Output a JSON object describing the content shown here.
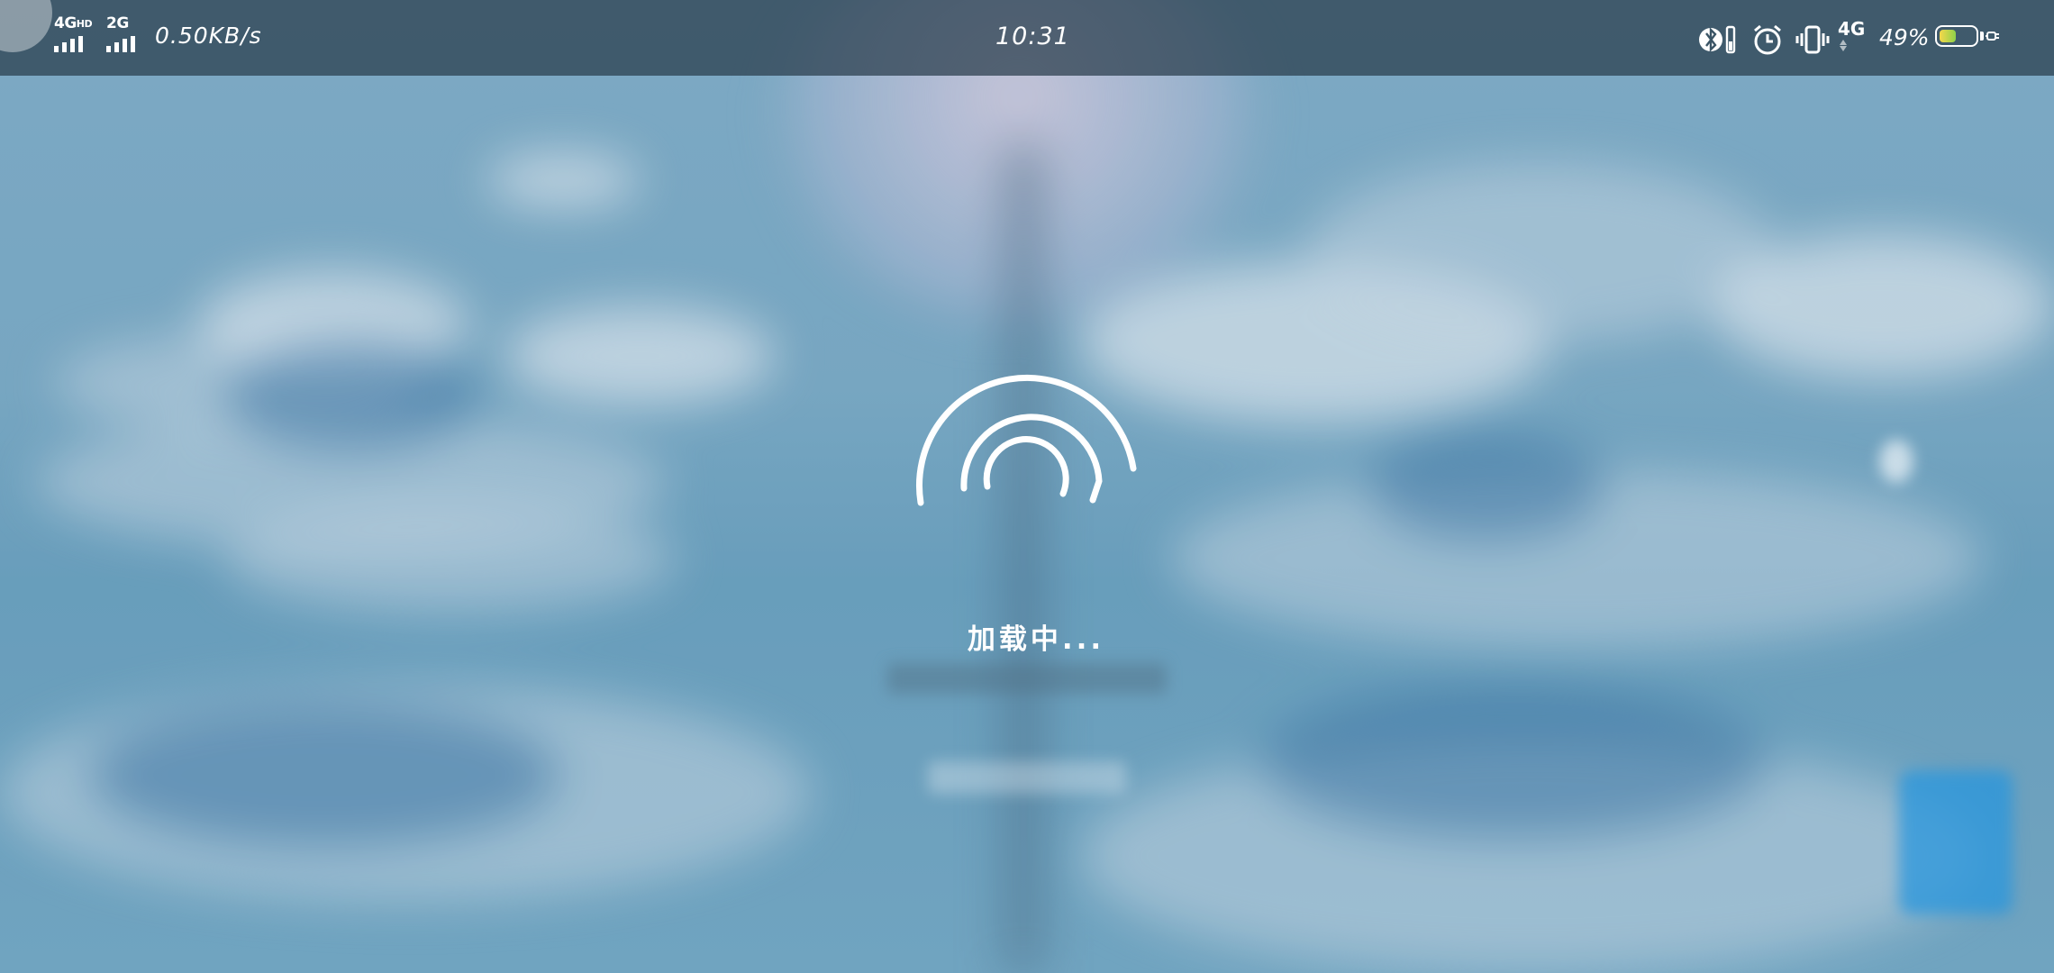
{
  "status_bar": {
    "network1": {
      "label": "4G",
      "sup": "HD"
    },
    "network2": {
      "label": "2G"
    },
    "speed": "0.50KB/s",
    "time": "10:31",
    "mobile_data": "4G",
    "battery_percent": "49%",
    "battery_level": 0.49
  },
  "loading": {
    "text": "加载中..."
  },
  "icons": {
    "bluetooth": "bluetooth-icon",
    "alarm": "alarm-icon",
    "vibrate": "vibrate-icon",
    "battery": "battery-icon",
    "charging": "charging-plug-icon",
    "spinner": "loading-arc-icon"
  }
}
